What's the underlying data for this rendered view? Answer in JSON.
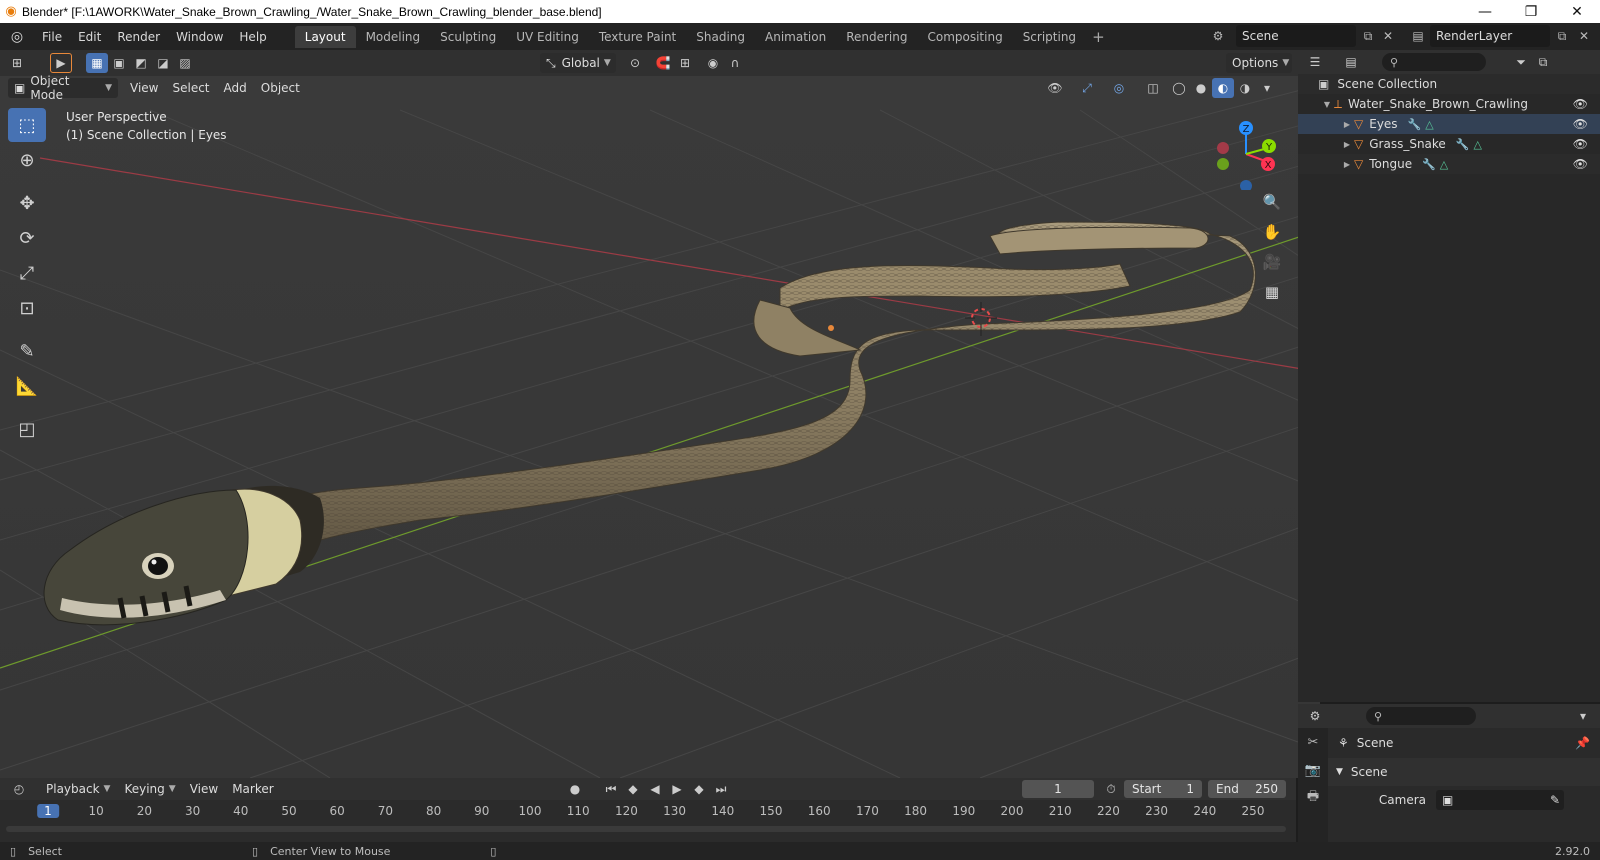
{
  "window": {
    "title": "Blender* [F:\\1AWORK\\Water_Snake_Brown_Crawling_/Water_Snake_Brown_Crawling_blender_base.blend]",
    "controls": [
      "minimize",
      "maximize",
      "close"
    ]
  },
  "menu": {
    "items": [
      "File",
      "Edit",
      "Render",
      "Window",
      "Help"
    ]
  },
  "workspaces": {
    "tabs": [
      "Layout",
      "Modeling",
      "Sculpting",
      "UV Editing",
      "Texture Paint",
      "Shading",
      "Animation",
      "Rendering",
      "Compositing",
      "Scripting"
    ],
    "active": "Layout",
    "add_label": "+"
  },
  "scene_selector": {
    "value": "Scene"
  },
  "view_layer_selector": {
    "value": "RenderLayer"
  },
  "viewport_header": {
    "transform_orientation": "Global",
    "options_label": "Options",
    "mode": "Object Mode",
    "menus": [
      "View",
      "Select",
      "Add",
      "Object"
    ]
  },
  "viewport_info": {
    "perspective": "User Perspective",
    "collection_line": "(1) Scene Collection | Eyes"
  },
  "gizmo_axes": {
    "x": "X",
    "y": "Y",
    "z": "Z",
    "colors": {
      "x": "#ff3352",
      "y": "#8bdc00",
      "z": "#2890ff"
    }
  },
  "outliner": {
    "root": "Scene Collection",
    "collection": "Water_Snake_Brown_Crawling",
    "objects": [
      {
        "name": "Eyes"
      },
      {
        "name": "Grass_Snake"
      },
      {
        "name": "Tongue"
      }
    ]
  },
  "properties": {
    "context": "Scene",
    "panel_title": "Scene",
    "field_label": "Camera"
  },
  "timeline": {
    "menus": [
      "Playback",
      "Keying",
      "View",
      "Marker"
    ],
    "current_frame": "1",
    "start_label": "Start",
    "start_value": "1",
    "end_label": "End",
    "end_value": "250",
    "ruler": [
      "1",
      "10",
      "20",
      "30",
      "40",
      "50",
      "60",
      "70",
      "80",
      "90",
      "100",
      "110",
      "120",
      "130",
      "140",
      "150",
      "160",
      "170",
      "180",
      "190",
      "200",
      "210",
      "220",
      "230",
      "240",
      "250"
    ]
  },
  "statusbar": {
    "left": "Select",
    "middle": "Center View to Mouse",
    "version": "2.92.0"
  },
  "colors": {
    "accent": "#4772b3",
    "viewport_bg": "#393939",
    "object_orange": "#e8883a"
  }
}
